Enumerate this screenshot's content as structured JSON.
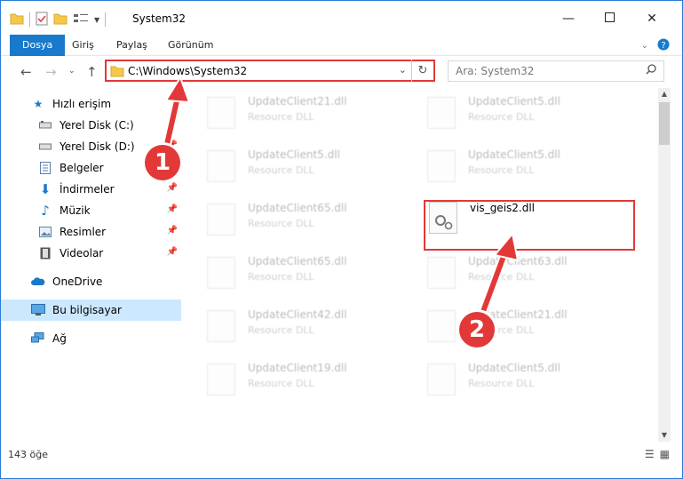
{
  "window": {
    "title": "System32"
  },
  "ribbon": {
    "tabs": [
      "Dosya",
      "Giriş",
      "Paylaş",
      "Görünüm"
    ]
  },
  "address": {
    "path": "C:\\Windows\\System32"
  },
  "search": {
    "placeholder": "Ara: System32"
  },
  "sidebar": {
    "items": [
      {
        "label": "Hızlı erişim"
      },
      {
        "label": "Yerel Disk (C:)"
      },
      {
        "label": "Yerel Disk (D:)"
      },
      {
        "label": "Belgeler"
      },
      {
        "label": "İndirmeler"
      },
      {
        "label": "Müzik"
      },
      {
        "label": "Resimler"
      },
      {
        "label": "Videolar"
      },
      {
        "label": "OneDrive"
      },
      {
        "label": "Bu bilgisayar"
      },
      {
        "label": "Ağ"
      }
    ]
  },
  "files": [
    {
      "name": "UpdateClient21.dll",
      "type": "Resource DLL"
    },
    {
      "name": "UpdateClient5.dll",
      "type": "Resource DLL"
    },
    {
      "name": "UpdateClient5.dll",
      "type": "Resource DLL"
    },
    {
      "name": "UpdateClient5.dll",
      "type": "Resource DLL"
    },
    {
      "name": "UpdateClient65.dll",
      "type": "Resource DLL"
    },
    {
      "name": "vis_geis2.dll",
      "type": ""
    },
    {
      "name": "UpdateClient65.dll",
      "type": "Resource DLL"
    },
    {
      "name": "UpdateClient63.dll",
      "type": "Resource DLL"
    },
    {
      "name": "UpdateClient42.dll",
      "type": "Resource DLL"
    },
    {
      "name": "UpdateClient21.dll",
      "type": "Resource DLL"
    },
    {
      "name": "UpdateClient19.dll",
      "type": "Resource DLL"
    },
    {
      "name": "UpdateClient5.dll",
      "type": "Resource DLL"
    }
  ],
  "status": {
    "count": "143 öğe"
  },
  "callouts": [
    "1",
    "2"
  ],
  "colors": {
    "accent": "#1979ca",
    "annotation": "#e23838",
    "selected": "#cce8ff"
  }
}
